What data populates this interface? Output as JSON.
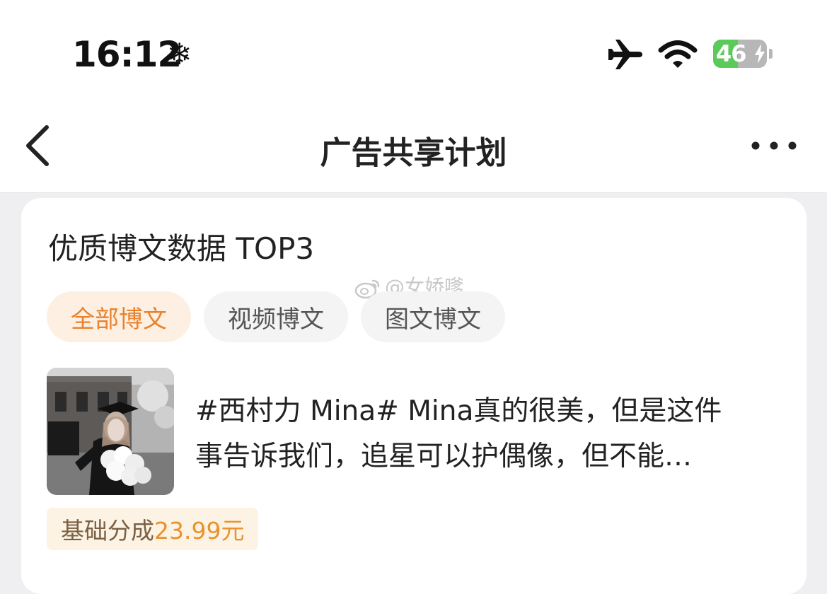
{
  "status_bar": {
    "time": "16:12",
    "status_glyph": "❄",
    "battery_level": "46",
    "battery_percent": 46,
    "icons": [
      "airplane-icon",
      "wifi-icon",
      "battery-icon",
      "charging-bolt-icon"
    ]
  },
  "nav": {
    "title": "广告共享计划",
    "back_icon": "chevron-left-icon",
    "more_icon": "more-dots-icon"
  },
  "card": {
    "title": "优质博文数据 TOP3",
    "watermark": "@女娇嗲",
    "tabs": [
      {
        "label": "全部博文",
        "active": true
      },
      {
        "label": "视频博文",
        "active": false
      },
      {
        "label": "图文博文",
        "active": false
      }
    ],
    "post": {
      "text_line1": "#西村力 Mina# Mina真的很美，但是这件",
      "text_line2": "事告诉我们，追星可以护偶像，但不能…",
      "earnings_label": "基础分成",
      "earnings_value": "23.99元"
    }
  },
  "colors": {
    "accent": "#e8822e",
    "accent_bg": "#fdf0e3",
    "battery_green": "#5cc95b"
  }
}
